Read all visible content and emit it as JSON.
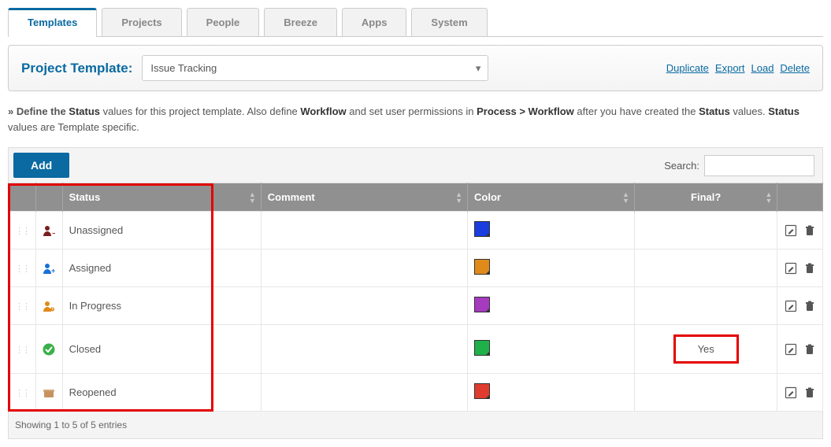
{
  "tabs": [
    {
      "label": "Templates",
      "active": true
    },
    {
      "label": "Projects"
    },
    {
      "label": "People"
    },
    {
      "label": "Breeze"
    },
    {
      "label": "Apps"
    },
    {
      "label": "System"
    }
  ],
  "panel": {
    "title": "Project Template:",
    "selected": "Issue Tracking",
    "actions": [
      "Duplicate",
      "Export",
      "Load",
      "Delete"
    ]
  },
  "description": {
    "prefix": "» Define the ",
    "s1": "Status",
    "mid1": " values for this project template. Also define ",
    "s2": "Workflow",
    "mid2": " and set user permissions in ",
    "s3": "Process > Workflow",
    "mid3": " after you have created the ",
    "s4": "Status",
    "mid4": " values. ",
    "s5": "Status",
    "end": " values are Template specific."
  },
  "toolbar": {
    "add_label": "Add",
    "search_label": "Search:"
  },
  "columns": {
    "status": "Status",
    "comment": "Comment",
    "color": "Color",
    "final": "Final?"
  },
  "rows": [
    {
      "status": "Unassigned",
      "icon": "person-unassigned",
      "icon_color": "#7a1f1f",
      "color": "#1a3de0",
      "final": ""
    },
    {
      "status": "Assigned",
      "icon": "person-assigned",
      "icon_color": "#1a6fd6",
      "color": "#e08a1a",
      "final": ""
    },
    {
      "status": "In Progress",
      "icon": "person-progress",
      "icon_color": "#e08a1a",
      "color": "#a63bbf",
      "final": ""
    },
    {
      "status": "Closed",
      "icon": "check-circle",
      "icon_color": "#3bb04a",
      "color": "#1fb04a",
      "final": "Yes"
    },
    {
      "status": "Reopened",
      "icon": "box-open",
      "icon_color": "#c7925d",
      "color": "#e03b2f",
      "final": ""
    }
  ],
  "footer": "Showing 1 to 5 of 5 entries"
}
